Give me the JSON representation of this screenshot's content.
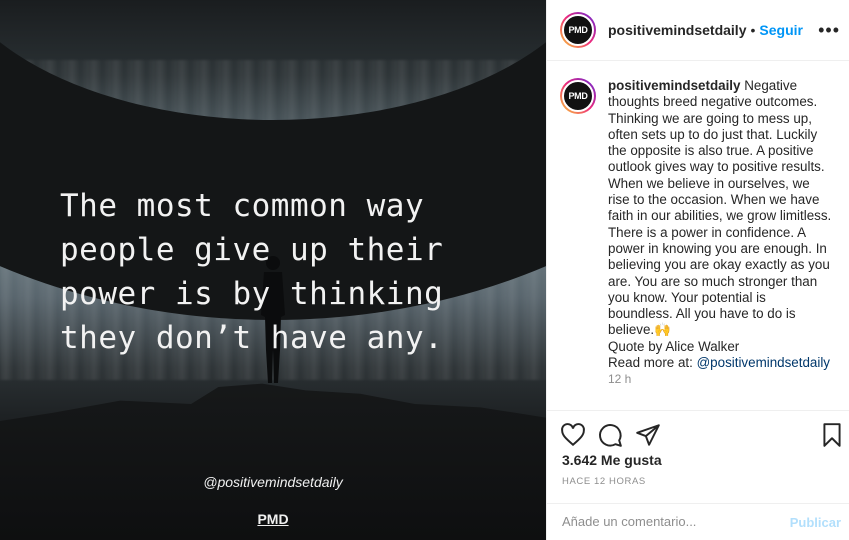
{
  "image": {
    "quote": "The most common way\npeople give up their\npower is by thinking\nthey don’t have any.",
    "handle": "@positivemindsetdaily",
    "logo": "PMD"
  },
  "header": {
    "avatar_text": "PMD",
    "username": "positivemindsetdaily",
    "separator": "•",
    "follow_label": "Seguir",
    "more_icon": "more-options-icon"
  },
  "caption": {
    "avatar_text": "PMD",
    "username": "positivemindsetdaily",
    "text": "Negative thoughts breed negative outcomes. Thinking we are going to mess up, often sets up to do just that. Luckily the opposite is also true. A positive outlook gives way to positive results. When we believe in ourselves, we rise to the occasion. When we have faith in our abilities, we grow limitless. There is a power in confidence. A power in knowing you are enough. In believing you are okay exactly as you are. You are so much stronger than you know. Your potential is boundless. All you have to do is believe.🙌",
    "quote_credit": "Quote by Alice Walker",
    "read_more_label": "Read more at: ",
    "read_more_mention": "@positivemindsetdaily",
    "time": "12 h"
  },
  "actions": {
    "icons": [
      "heart-icon",
      "comment-icon",
      "share-icon",
      "bookmark-icon"
    ]
  },
  "stats": {
    "likes": "3.642 Me gusta",
    "ago": "HACE 12 HORAS"
  },
  "comment": {
    "placeholder": "Añade un comentario...",
    "publish_label": "Publicar"
  },
  "colors": {
    "link": "#0095f6",
    "publish_disabled": "#b2dffc",
    "mention": "#00376b"
  }
}
